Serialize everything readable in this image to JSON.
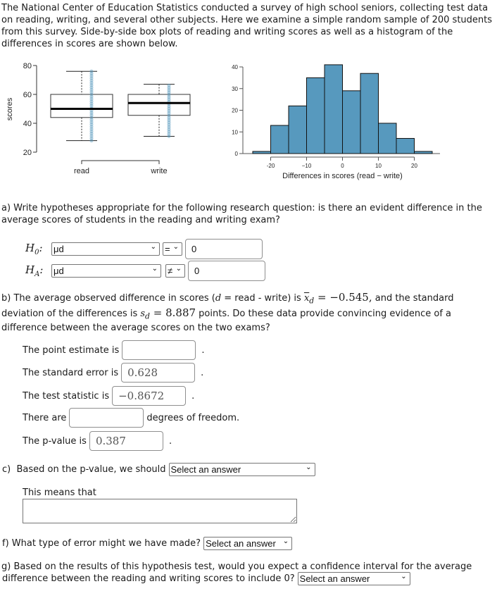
{
  "intro": "The National Center of Education Statistics conducted a survey of high school seniors, collecting test data on reading, writing, and several other subjects. Here we examine a simple random sample of 200 students from this survey. Side-by-side box plots of reading and writing scores as well as a histogram of the differences in scores are shown below.",
  "chart_data": [
    {
      "type": "box",
      "ylabel": "scores",
      "ylim": [
        20,
        80
      ],
      "yticks": [
        20,
        40,
        60,
        80
      ],
      "categories": [
        "read",
        "write"
      ],
      "series": [
        {
          "name": "read",
          "min": 28,
          "q1": 44,
          "median": 50,
          "q3": 60,
          "max": 76
        },
        {
          "name": "write",
          "min": 31,
          "q1": 45.5,
          "median": 54,
          "q3": 60,
          "max": 67
        }
      ],
      "colors": {
        "points": "#5a9bbf",
        "box": "#000000"
      }
    },
    {
      "type": "bar",
      "title": "",
      "xlabel": "Differences in scores (read − write)",
      "ylabel": "",
      "bin_edges": [
        -25,
        -20,
        -15,
        -10,
        -5,
        0,
        5,
        10,
        15,
        20,
        25
      ],
      "values": [
        1,
        13,
        22,
        35,
        41,
        29,
        37,
        14,
        7,
        1
      ],
      "xticks": [
        "-20",
        "−10",
        "0",
        "10",
        "20"
      ],
      "xtick_values": [
        -20,
        -10,
        0,
        10,
        20
      ],
      "yticks": [
        0,
        10,
        20,
        30,
        40
      ],
      "ylim": [
        0,
        40
      ],
      "colors": {
        "bar": "#5799be",
        "edge": "#111111"
      }
    }
  ],
  "part_a": {
    "question": "a) Write hypotheses appropriate for the following research question: is there an evident difference in the average scores of students in the reading and writing exam?",
    "h0": {
      "label_main": "H",
      "label_sub": "0",
      "param": "μd",
      "op": "=",
      "value": "0"
    },
    "ha": {
      "label_main": "H",
      "label_sub": "A",
      "param": "μd",
      "op": "≠",
      "value": "0"
    }
  },
  "part_b": {
    "text1": "b) The average observed difference in scores (",
    "d": "d",
    "text2": " = read - write) is ",
    "xbar": "x̅",
    "sub_d": "d",
    "eq_val1": " = −0.545,",
    "text3": " and the standard deviation of the differences is ",
    "s": "s",
    "eq_val2": " = 8.887",
    "text4": " points. Do these data provide convincing evidence of a difference between the average scores on the two exams?",
    "point_estimate_label": "The point estimate is",
    "point_estimate_value": "",
    "standard_error_label": "The standard error is",
    "standard_error_value": "0.628",
    "test_statistic_label": "The test statistic is",
    "test_statistic_value": "−0.8672",
    "df_label_pre": "There are",
    "df_value": "",
    "df_label_post": "degrees of freedom.",
    "pvalue_label": "The p-value is",
    "pvalue_value": "0.387",
    "period": "."
  },
  "part_c": {
    "question": "c)  Based on the p-value, we should",
    "select": "Select an answer",
    "means_label": "This means that",
    "means_value": ""
  },
  "part_f": {
    "question": "f) What type of error might we have made?",
    "select": "Select an answer"
  },
  "part_g": {
    "question1": "g) Based on the results of this hypothesis test, would you expect a confidence interval for the average",
    "question2": "difference between the reading and writing scores to include 0?",
    "select": "Select an answer"
  },
  "icons": {
    "chevron": "⌵"
  }
}
